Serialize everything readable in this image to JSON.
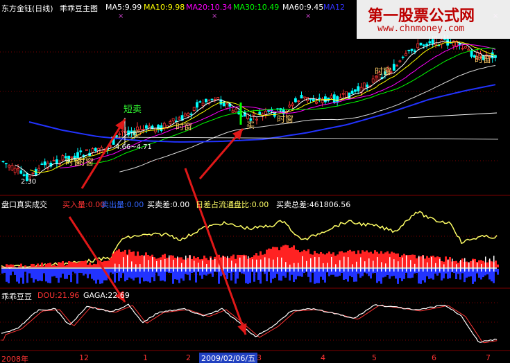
{
  "header": {
    "title": "东方金钰(日线)",
    "indicator": "乖乖豆主图",
    "ma": [
      {
        "label": "MA5:9.99",
        "color": "#ffffff"
      },
      {
        "label": "MA10:9.98",
        "color": "#ffff00"
      },
      {
        "label": "MA20:10.34",
        "color": "#ff00ff"
      },
      {
        "label": "MA30:10.49",
        "color": "#00ff00"
      },
      {
        "label": "MA60:9.45",
        "color": "#ffffff"
      },
      {
        "label": "MA12",
        "color": "#3333ff"
      }
    ]
  },
  "annotations": {
    "short_sell": "短卖",
    "buy": "买",
    "timing": "时窗",
    "price_range": "4.66~4.71",
    "low_price": "2.30"
  },
  "panel2": {
    "title": "盘口真实成交",
    "buy_label": "买入量:0.00",
    "sell_label": "卖出量:0.00",
    "diff_label": "买卖差:0.00",
    "ratio_label": "日差占流通盘比:0.00",
    "total_label": "买卖总差:461806.56"
  },
  "panel3": {
    "title": "乖乖豆豆",
    "dou_label": "DOU:21.96",
    "gaga_label": "GAGA:22.69"
  },
  "xaxis": {
    "labels": [
      "2008年",
      "12",
      "1",
      "2",
      "3",
      "4",
      "5",
      "6",
      "7"
    ],
    "cursor_date": "2009/02/06/五"
  },
  "watermark": {
    "line1": "第一股票公式网",
    "line2": "www.chnmoney.com"
  },
  "colors": {
    "up": "#ff3333",
    "down": "#00ffff",
    "ma_blue": "#2233ff",
    "arrow": "#e01818",
    "grid": "#800000"
  },
  "chart_data": [
    {
      "type": "candlestick",
      "title": "东方金钰(日线)",
      "series": [
        {
          "name": "MA5",
          "values": [
            9.99
          ]
        },
        {
          "name": "MA10",
          "values": [
            9.98
          ]
        },
        {
          "name": "MA20",
          "values": [
            10.34
          ]
        },
        {
          "name": "MA30",
          "values": [
            10.49
          ]
        },
        {
          "name": "MA60",
          "values": [
            9.45
          ]
        }
      ],
      "annotations": [
        "短卖",
        "买",
        "时窗",
        "4.66~4.71",
        "2.30"
      ],
      "x": [
        "2008年",
        "12",
        "1",
        "2",
        "3",
        "4",
        "5",
        "6",
        "7"
      ]
    },
    {
      "type": "bar",
      "title": "盘口真实成交",
      "series": [
        {
          "name": "买入量",
          "values": [
            0.0
          ]
        },
        {
          "name": "卖出量",
          "values": [
            0.0
          ]
        },
        {
          "name": "买卖差",
          "values": [
            0.0
          ]
        },
        {
          "name": "日差占流通盘比",
          "values": [
            0.0
          ]
        },
        {
          "name": "买卖总差",
          "values": [
            461806.56
          ]
        }
      ]
    },
    {
      "type": "line",
      "title": "乖乖豆豆",
      "series": [
        {
          "name": "DOU",
          "values": [
            21.96
          ]
        },
        {
          "name": "GAGA",
          "values": [
            22.69
          ]
        }
      ]
    }
  ]
}
